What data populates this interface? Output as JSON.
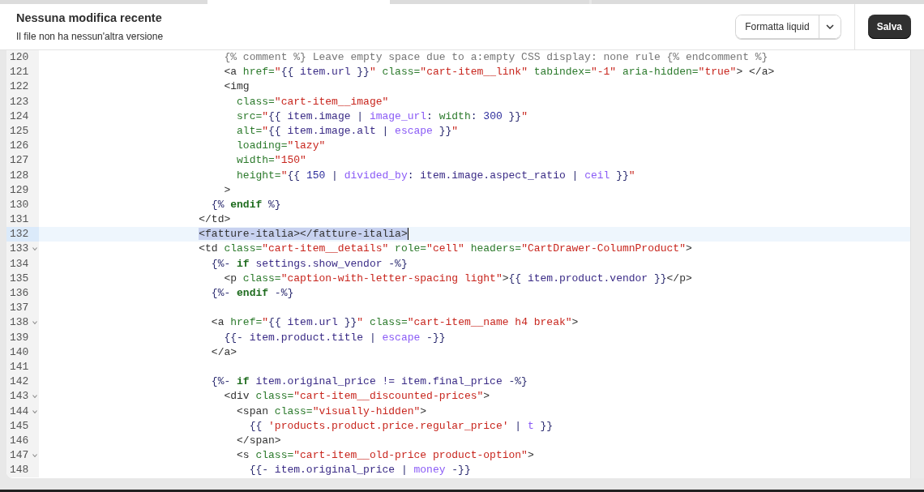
{
  "header": {
    "title": "Nessuna modifica recente",
    "subtitle": "Il file non ha nessun'altra versione",
    "format_button": "Formatta liquid",
    "save_button": "Salva"
  },
  "editor": {
    "lines": [
      {
        "number": "120",
        "foldable": false,
        "current": false,
        "tokens": [
          {
            "kind": "comment",
            "text": "                            {% comment %} Leave empty space due to a:empty CSS display: none rule {% endcomment %}"
          }
        ]
      },
      {
        "number": "121",
        "foldable": false,
        "current": false,
        "tokens": [
          {
            "kind": "tag",
            "text": "                            <a "
          },
          {
            "kind": "attr",
            "text": "href="
          },
          {
            "kind": "str",
            "text": "\""
          },
          {
            "kind": "liquid",
            "text": "{{ "
          },
          {
            "kind": "var",
            "text": "item.url"
          },
          {
            "kind": "liquid",
            "text": " }}"
          },
          {
            "kind": "str",
            "text": "\""
          },
          {
            "kind": "attr",
            "text": " class="
          },
          {
            "kind": "str",
            "text": "\"cart-item__link\""
          },
          {
            "kind": "attr",
            "text": " tabindex="
          },
          {
            "kind": "str",
            "text": "\"-1\""
          },
          {
            "kind": "attr",
            "text": " aria-hidden="
          },
          {
            "kind": "str",
            "text": "\"true\""
          },
          {
            "kind": "tag",
            "text": "> </a>"
          }
        ]
      },
      {
        "number": "122",
        "foldable": false,
        "current": false,
        "tokens": [
          {
            "kind": "tag",
            "text": "                            <img"
          }
        ]
      },
      {
        "number": "123",
        "foldable": false,
        "current": false,
        "tokens": [
          {
            "kind": "attr",
            "text": "                              class="
          },
          {
            "kind": "str",
            "text": "\"cart-item__image\""
          }
        ]
      },
      {
        "number": "124",
        "foldable": false,
        "current": false,
        "tokens": [
          {
            "kind": "attr",
            "text": "                              src="
          },
          {
            "kind": "str",
            "text": "\""
          },
          {
            "kind": "liquid",
            "text": "{{ "
          },
          {
            "kind": "var",
            "text": "item.image"
          },
          {
            "kind": "liquid",
            "text": " | "
          },
          {
            "kind": "filter",
            "text": "image_url"
          },
          {
            "kind": "liquid",
            "text": ": "
          },
          {
            "kind": "attr",
            "text": "width"
          },
          {
            "kind": "liquid",
            "text": ": "
          },
          {
            "kind": "num",
            "text": "300"
          },
          {
            "kind": "liquid",
            "text": " }}"
          },
          {
            "kind": "str",
            "text": "\""
          }
        ]
      },
      {
        "number": "125",
        "foldable": false,
        "current": false,
        "tokens": [
          {
            "kind": "attr",
            "text": "                              alt="
          },
          {
            "kind": "str",
            "text": "\""
          },
          {
            "kind": "liquid",
            "text": "{{ "
          },
          {
            "kind": "var",
            "text": "item.image.alt"
          },
          {
            "kind": "liquid",
            "text": " | "
          },
          {
            "kind": "filter",
            "text": "escape"
          },
          {
            "kind": "liquid",
            "text": " }}"
          },
          {
            "kind": "str",
            "text": "\""
          }
        ]
      },
      {
        "number": "126",
        "foldable": false,
        "current": false,
        "tokens": [
          {
            "kind": "attr",
            "text": "                              loading="
          },
          {
            "kind": "str",
            "text": "\"lazy\""
          }
        ]
      },
      {
        "number": "127",
        "foldable": false,
        "current": false,
        "tokens": [
          {
            "kind": "attr",
            "text": "                              width="
          },
          {
            "kind": "str",
            "text": "\"150\""
          }
        ]
      },
      {
        "number": "128",
        "foldable": false,
        "current": false,
        "tokens": [
          {
            "kind": "attr",
            "text": "                              height="
          },
          {
            "kind": "str",
            "text": "\""
          },
          {
            "kind": "liquid",
            "text": "{{ "
          },
          {
            "kind": "num",
            "text": "150"
          },
          {
            "kind": "liquid",
            "text": " | "
          },
          {
            "kind": "filter",
            "text": "divided_by"
          },
          {
            "kind": "liquid",
            "text": ": "
          },
          {
            "kind": "var",
            "text": "item.image.aspect_ratio"
          },
          {
            "kind": "liquid",
            "text": " | "
          },
          {
            "kind": "filter",
            "text": "ceil"
          },
          {
            "kind": "liquid",
            "text": " }}"
          },
          {
            "kind": "str",
            "text": "\""
          }
        ]
      },
      {
        "number": "129",
        "foldable": false,
        "current": false,
        "tokens": [
          {
            "kind": "tag",
            "text": "                            >"
          }
        ]
      },
      {
        "number": "130",
        "foldable": false,
        "current": false,
        "tokens": [
          {
            "kind": "liquid",
            "text": "                          {% "
          },
          {
            "kind": "keyword",
            "text": "endif"
          },
          {
            "kind": "liquid",
            "text": " %}"
          }
        ]
      },
      {
        "number": "131",
        "foldable": false,
        "current": false,
        "tokens": [
          {
            "kind": "tag",
            "text": "                        </td>"
          }
        ]
      },
      {
        "number": "132",
        "foldable": false,
        "current": true,
        "tokens": [
          {
            "kind": "selection",
            "text": "                        <fatture-italia></fatture-italia>"
          }
        ]
      },
      {
        "number": "133",
        "foldable": true,
        "current": false,
        "tokens": [
          {
            "kind": "tag",
            "text": "                        <td "
          },
          {
            "kind": "attr",
            "text": "class="
          },
          {
            "kind": "str",
            "text": "\"cart-item__details\""
          },
          {
            "kind": "attr",
            "text": " role="
          },
          {
            "kind": "str",
            "text": "\"cell\""
          },
          {
            "kind": "attr",
            "text": " headers="
          },
          {
            "kind": "str",
            "text": "\"CartDrawer-ColumnProduct\""
          },
          {
            "kind": "tag",
            "text": ">"
          }
        ]
      },
      {
        "number": "134",
        "foldable": false,
        "current": false,
        "tokens": [
          {
            "kind": "liquid",
            "text": "                          {%- "
          },
          {
            "kind": "keyword",
            "text": "if"
          },
          {
            "kind": "var",
            "text": " settings.show_vendor"
          },
          {
            "kind": "liquid",
            "text": " -%}"
          }
        ]
      },
      {
        "number": "135",
        "foldable": false,
        "current": false,
        "tokens": [
          {
            "kind": "tag",
            "text": "                            <p "
          },
          {
            "kind": "attr",
            "text": "class="
          },
          {
            "kind": "str",
            "text": "\"caption-with-letter-spacing light\""
          },
          {
            "kind": "tag",
            "text": ">"
          },
          {
            "kind": "liquid",
            "text": "{{ "
          },
          {
            "kind": "var",
            "text": "item.product.vendor"
          },
          {
            "kind": "liquid",
            "text": " }}"
          },
          {
            "kind": "tag",
            "text": "</p>"
          }
        ]
      },
      {
        "number": "136",
        "foldable": false,
        "current": false,
        "tokens": [
          {
            "kind": "liquid",
            "text": "                          {%- "
          },
          {
            "kind": "keyword",
            "text": "endif"
          },
          {
            "kind": "liquid",
            "text": " -%}"
          }
        ]
      },
      {
        "number": "137",
        "foldable": false,
        "current": false
      },
      {
        "number": "138",
        "foldable": true,
        "current": false,
        "tokens": [
          {
            "kind": "tag",
            "text": "                          <a "
          },
          {
            "kind": "attr",
            "text": "href="
          },
          {
            "kind": "str",
            "text": "\""
          },
          {
            "kind": "liquid",
            "text": "{{ "
          },
          {
            "kind": "var",
            "text": "item.url"
          },
          {
            "kind": "liquid",
            "text": " }}"
          },
          {
            "kind": "str",
            "text": "\""
          },
          {
            "kind": "attr",
            "text": " class="
          },
          {
            "kind": "str",
            "text": "\"cart-item__name h4 break\""
          },
          {
            "kind": "tag",
            "text": ">"
          }
        ]
      },
      {
        "number": "139",
        "foldable": false,
        "current": false,
        "tokens": [
          {
            "kind": "liquid",
            "text": "                            {{- "
          },
          {
            "kind": "var",
            "text": "item.product.title"
          },
          {
            "kind": "liquid",
            "text": " | "
          },
          {
            "kind": "filter",
            "text": "escape"
          },
          {
            "kind": "liquid",
            "text": " -}}"
          }
        ]
      },
      {
        "number": "140",
        "foldable": false,
        "current": false,
        "tokens": [
          {
            "kind": "tag",
            "text": "                          </a>"
          }
        ]
      },
      {
        "number": "141",
        "foldable": false,
        "current": false
      },
      {
        "number": "142",
        "foldable": false,
        "current": false,
        "tokens": [
          {
            "kind": "liquid",
            "text": "                          {%- "
          },
          {
            "kind": "keyword",
            "text": "if"
          },
          {
            "kind": "var",
            "text": " item.original_price != item.final_price"
          },
          {
            "kind": "liquid",
            "text": " -%}"
          }
        ]
      },
      {
        "number": "143",
        "foldable": true,
        "current": false,
        "tokens": [
          {
            "kind": "tag",
            "text": "                            <div "
          },
          {
            "kind": "attr",
            "text": "class="
          },
          {
            "kind": "str",
            "text": "\"cart-item__discounted-prices\""
          },
          {
            "kind": "tag",
            "text": ">"
          }
        ]
      },
      {
        "number": "144",
        "foldable": true,
        "current": false,
        "tokens": [
          {
            "kind": "tag",
            "text": "                              <span "
          },
          {
            "kind": "attr",
            "text": "class="
          },
          {
            "kind": "str",
            "text": "\"visually-hidden\""
          },
          {
            "kind": "tag",
            "text": ">"
          }
        ]
      },
      {
        "number": "145",
        "foldable": false,
        "current": false,
        "tokens": [
          {
            "kind": "liquid",
            "text": "                                {{ "
          },
          {
            "kind": "str",
            "text": "'products.product.price.regular_price'"
          },
          {
            "kind": "liquid",
            "text": " | "
          },
          {
            "kind": "filter",
            "text": "t"
          },
          {
            "kind": "liquid",
            "text": " }}"
          }
        ]
      },
      {
        "number": "146",
        "foldable": false,
        "current": false,
        "tokens": [
          {
            "kind": "tag",
            "text": "                              </span>"
          }
        ]
      },
      {
        "number": "147",
        "foldable": true,
        "current": false,
        "tokens": [
          {
            "kind": "tag",
            "text": "                              <s "
          },
          {
            "kind": "attr",
            "text": "class="
          },
          {
            "kind": "str",
            "text": "\"cart-item__old-price product-option\""
          },
          {
            "kind": "tag",
            "text": ">"
          }
        ]
      },
      {
        "number": "148",
        "foldable": false,
        "current": false,
        "tokens": [
          {
            "kind": "liquid",
            "text": "                                {{- "
          },
          {
            "kind": "var",
            "text": "item.original_price"
          },
          {
            "kind": "liquid",
            "text": " | "
          },
          {
            "kind": "filter",
            "text": "money"
          },
          {
            "kind": "liquid",
            "text": " -}}"
          }
        ]
      }
    ]
  }
}
